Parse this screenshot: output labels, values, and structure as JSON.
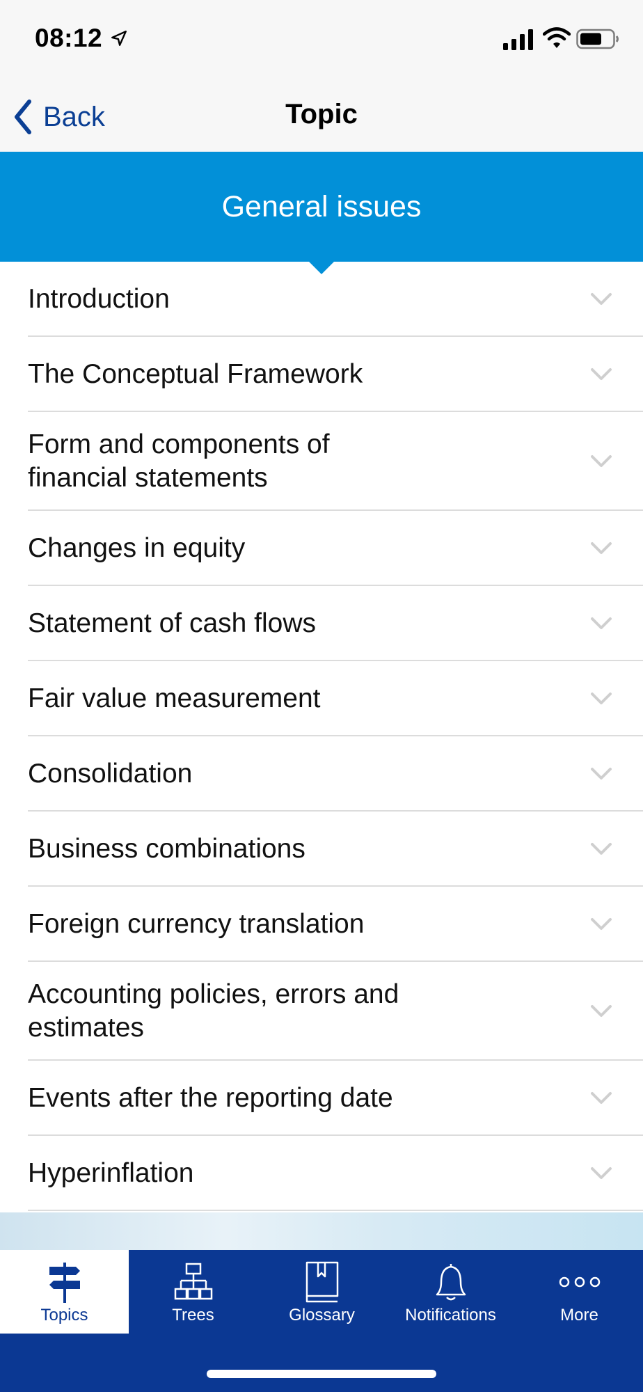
{
  "status_bar": {
    "time": "08:12"
  },
  "nav": {
    "back_label": "Back",
    "title": "Topic"
  },
  "section": {
    "title": "General issues"
  },
  "topics": [
    {
      "label": "Introduction"
    },
    {
      "label": "The Conceptual Framework"
    },
    {
      "label": "Form and components of financial statements"
    },
    {
      "label": "Changes in equity"
    },
    {
      "label": "Statement of cash flows"
    },
    {
      "label": "Fair value measurement"
    },
    {
      "label": "Consolidation"
    },
    {
      "label": "Business combinations"
    },
    {
      "label": "Foreign currency translation"
    },
    {
      "label": "Accounting policies, errors and estimates"
    },
    {
      "label": "Events after the reporting date"
    },
    {
      "label": "Hyperinflation"
    }
  ],
  "tabs": [
    {
      "label": "Topics",
      "icon": "signpost-icon",
      "active": true
    },
    {
      "label": "Trees",
      "icon": "tree-diagram-icon",
      "active": false
    },
    {
      "label": "Glossary",
      "icon": "book-icon",
      "active": false
    },
    {
      "label": "Notifications",
      "icon": "bell-icon",
      "active": false
    },
    {
      "label": "More",
      "icon": "more-dots-icon",
      "active": false
    }
  ],
  "colors": {
    "header_blue": "#0290d8",
    "tab_bar_navy": "#0b3893",
    "link_blue": "#0b3f94",
    "chevron_gray": "#cfcfcf"
  }
}
